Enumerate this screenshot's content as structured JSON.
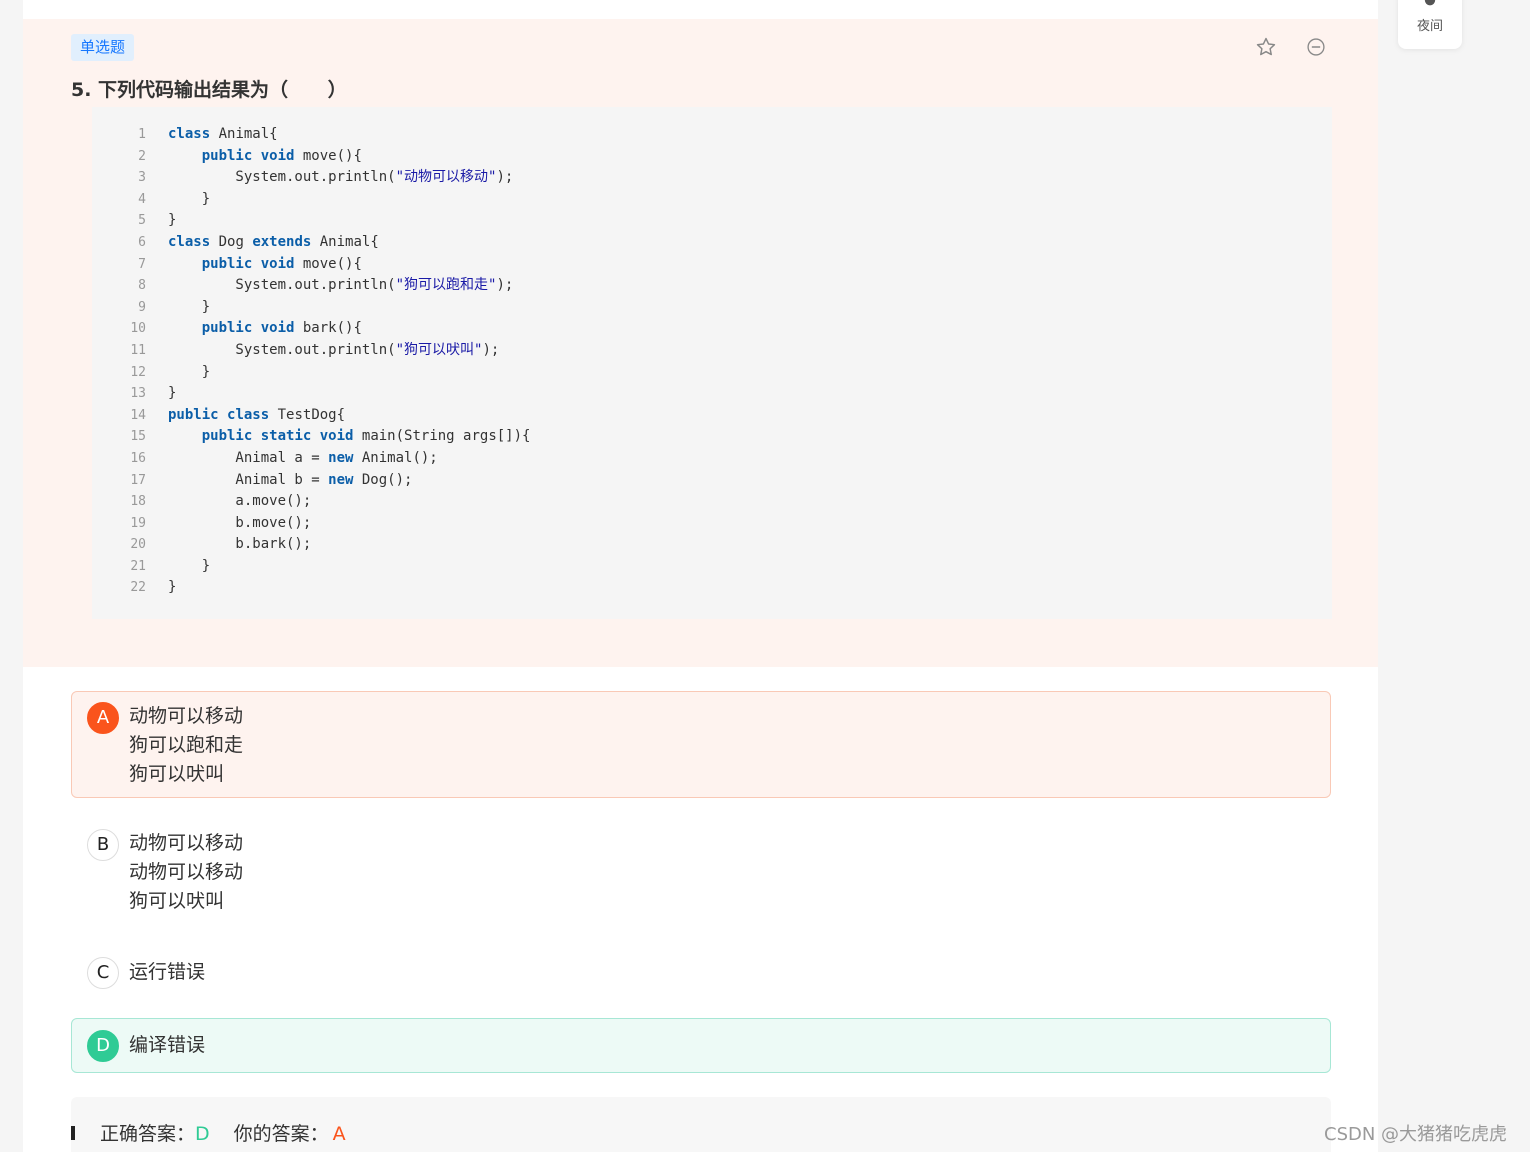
{
  "question": {
    "type_tag": "单选题",
    "title": "5. 下列代码输出结果为（      ）",
    "code_lines": [
      {
        "n": "1",
        "html": "<span class=\"kw\">class</span> Animal{"
      },
      {
        "n": "2",
        "html": "    <span class=\"kw\">public</span> <span class=\"kw\">void</span> move(){"
      },
      {
        "n": "3",
        "html": "        System.out.println(<span class=\"str\">\"动物可以移动\"</span>);"
      },
      {
        "n": "4",
        "html": "    }"
      },
      {
        "n": "5",
        "html": "}"
      },
      {
        "n": "6",
        "html": "<span class=\"kw\">class</span> Dog <span class=\"kw\">extends</span> Animal{"
      },
      {
        "n": "7",
        "html": "    <span class=\"kw\">public</span> <span class=\"kw\">void</span> move(){"
      },
      {
        "n": "8",
        "html": "        System.out.println(<span class=\"str\">\"狗可以跑和走\"</span>);"
      },
      {
        "n": "9",
        "html": "    }"
      },
      {
        "n": "10",
        "html": "    <span class=\"kw\">public</span> <span class=\"kw\">void</span> bark(){"
      },
      {
        "n": "11",
        "html": "        System.out.println(<span class=\"str\">\"狗可以吠叫\"</span>);"
      },
      {
        "n": "12",
        "html": "    }"
      },
      {
        "n": "13",
        "html": "}"
      },
      {
        "n": "14",
        "html": "<span class=\"kw\">public</span> <span class=\"kw\">class</span> TestDog{"
      },
      {
        "n": "15",
        "html": "    <span class=\"kw\">public</span> <span class=\"kw\">static</span> <span class=\"kw\">void</span> main(String args[]){"
      },
      {
        "n": "16",
        "html": "        Animal a = <span class=\"kw\">new</span> Animal();"
      },
      {
        "n": "17",
        "html": "        Animal b = <span class=\"kw\">new</span> Dog();"
      },
      {
        "n": "18",
        "html": "        a.move();"
      },
      {
        "n": "19",
        "html": "        b.move();"
      },
      {
        "n": "20",
        "html": "        b.bark();"
      },
      {
        "n": "21",
        "html": "    }"
      },
      {
        "n": "22",
        "html": "}"
      }
    ]
  },
  "options": [
    {
      "letter": "A",
      "text": "动物可以移动\n狗可以跑和走\n狗可以吠叫",
      "state": "wrong"
    },
    {
      "letter": "B",
      "text": "动物可以移动\n动物可以移动\n狗可以吠叫",
      "state": "normal"
    },
    {
      "letter": "C",
      "text": "运行错误",
      "state": "normal"
    },
    {
      "letter": "D",
      "text": "编译错误",
      "state": "correct"
    }
  ],
  "answer": {
    "correct_label": "正确答案：",
    "correct_value": "D",
    "yours_label": "你的答案：",
    "yours_value": "A"
  },
  "toolbar": {
    "night_label": "夜间"
  },
  "icons": {
    "favorite": "star-outline-icon",
    "remove": "minus-circle-icon",
    "night": "moon-icon"
  },
  "colors": {
    "wrong": "#fa541c",
    "correct": "#2fcb95",
    "keyword": "#0b5ea8",
    "string": "#1a1aa6",
    "tag": "#1677ff"
  },
  "watermark": "CSDN @大猪猪吃虎虎"
}
